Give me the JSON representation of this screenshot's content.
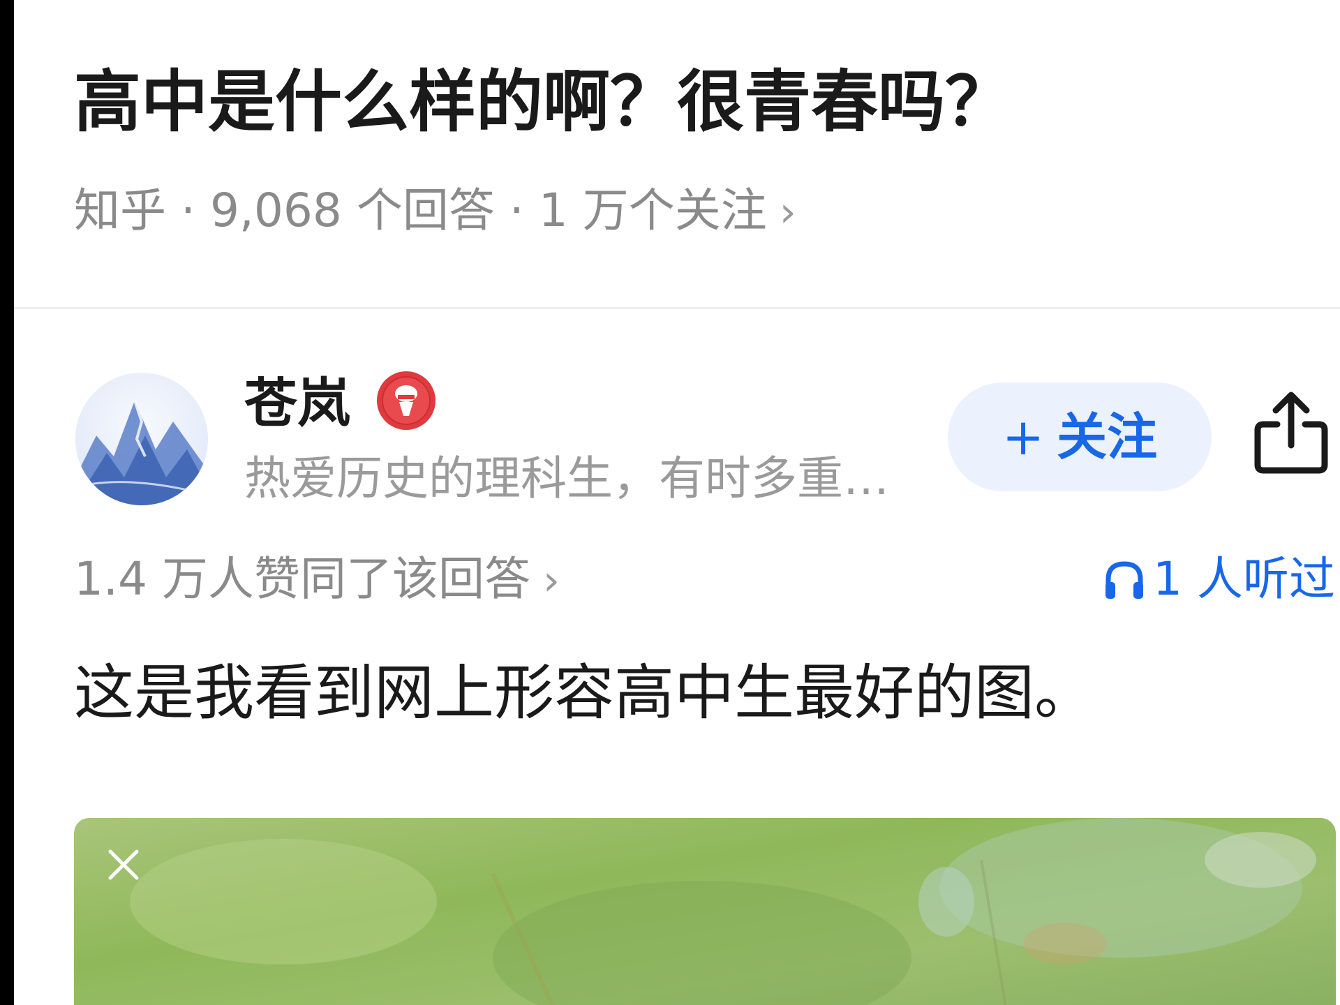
{
  "question": {
    "title": "高中是什么样的啊？很青春吗？",
    "meta": "知乎 · 9,068 个回答 · 1 万个关注",
    "meta_chevron": "›"
  },
  "author": {
    "name": "苍岚",
    "bio": "热爱历史的理科生，有时多重…",
    "badge_icon": "microphone-badge-icon",
    "avatar_icon": "landscape-avatar"
  },
  "actions": {
    "follow_plus": "+",
    "follow_label": "关注",
    "share_icon": "share-icon"
  },
  "stats": {
    "upvotes": "1.4 万人赞同了该回答",
    "upvotes_chevron": "›",
    "listened": "1 人听过",
    "listened_icon": "headphones-icon"
  },
  "answer": {
    "text": "这是我看到网上形容高中生最好的图。",
    "image_close_icon": "close-icon"
  },
  "colors": {
    "accent": "#1767e8",
    "follow_bg": "#ebf2fe",
    "meta_gray": "#8a8a8a",
    "badge_red": "#e03a3e"
  }
}
